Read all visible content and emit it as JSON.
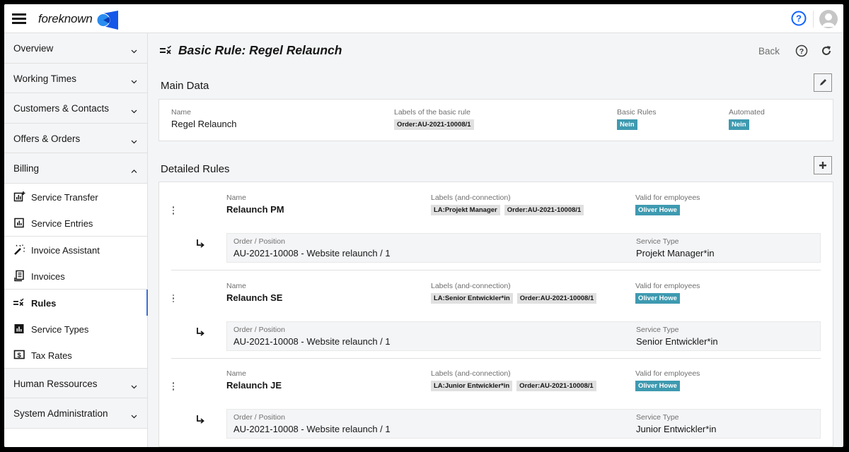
{
  "header": {
    "brand": "foreknown",
    "help_icon": "help-circle-icon",
    "avatar_icon": "user-avatar-icon",
    "accent_color": "#0f62fe"
  },
  "sidebar": {
    "groups_top": [
      {
        "label": "Overview",
        "expanded": false
      },
      {
        "label": "Working Times",
        "expanded": false
      },
      {
        "label": "Customers & Contacts",
        "expanded": false
      },
      {
        "label": "Offers & Orders",
        "expanded": false
      },
      {
        "label": "Billing",
        "expanded": true
      }
    ],
    "billing_items": [
      {
        "label": "Service Transfer",
        "icon": "chart-add-icon"
      },
      {
        "label": "Service Entries",
        "icon": "chart-box-icon"
      },
      {
        "label": "Invoice Assistant",
        "icon": "magic-wand-icon"
      },
      {
        "label": "Invoices",
        "icon": "receipt-icon"
      },
      {
        "label": "Rules",
        "icon": "rules-icon",
        "active": true
      },
      {
        "label": "Service Types",
        "icon": "chart-filled-icon"
      },
      {
        "label": "Tax Rates",
        "icon": "dollar-box-icon"
      }
    ],
    "groups_bottom": [
      {
        "label": "Human Ressources",
        "expanded": false
      },
      {
        "label": "System Administration",
        "expanded": false
      }
    ]
  },
  "page": {
    "title": "Basic Rule: Regel Relaunch",
    "back_label": "Back"
  },
  "main_data": {
    "section_title": "Main Data",
    "name_label": "Name",
    "name_value": "Regel Relaunch",
    "labels_label": "Labels of the basic rule",
    "labels": [
      "Order:AU-2021-10008/1"
    ],
    "basic_rules_label": "Basic Rules",
    "basic_rules_value": "Nein",
    "automated_label": "Automated",
    "automated_value": "Nein"
  },
  "detailed_rules": {
    "section_title": "Detailed Rules",
    "name_label": "Name",
    "labels_label": "Labels (and-connection)",
    "valid_label": "Valid for employees",
    "order_label": "Order / Position",
    "service_type_label": "Service Type",
    "rules": [
      {
        "name": "Relaunch PM",
        "labels": [
          "LA:Projekt Manager",
          "Order:AU-2021-10008/1"
        ],
        "employees": [
          "Oliver Howe"
        ],
        "order_position": "AU-2021-10008 - Website relaunch / 1",
        "service_type": "Projekt Manager*in"
      },
      {
        "name": "Relaunch SE",
        "labels": [
          "LA:Senior Entwickler*in",
          "Order:AU-2021-10008/1"
        ],
        "employees": [
          "Oliver Howe"
        ],
        "order_position": "AU-2021-10008 - Website relaunch / 1",
        "service_type": "Senior Entwickler*in"
      },
      {
        "name": "Relaunch JE",
        "labels": [
          "LA:Junior Entwickler*in",
          "Order:AU-2021-10008/1"
        ],
        "employees": [
          "Oliver Howe"
        ],
        "order_position": "AU-2021-10008 - Website relaunch / 1",
        "service_type": "Junior Entwickler*in"
      }
    ]
  }
}
